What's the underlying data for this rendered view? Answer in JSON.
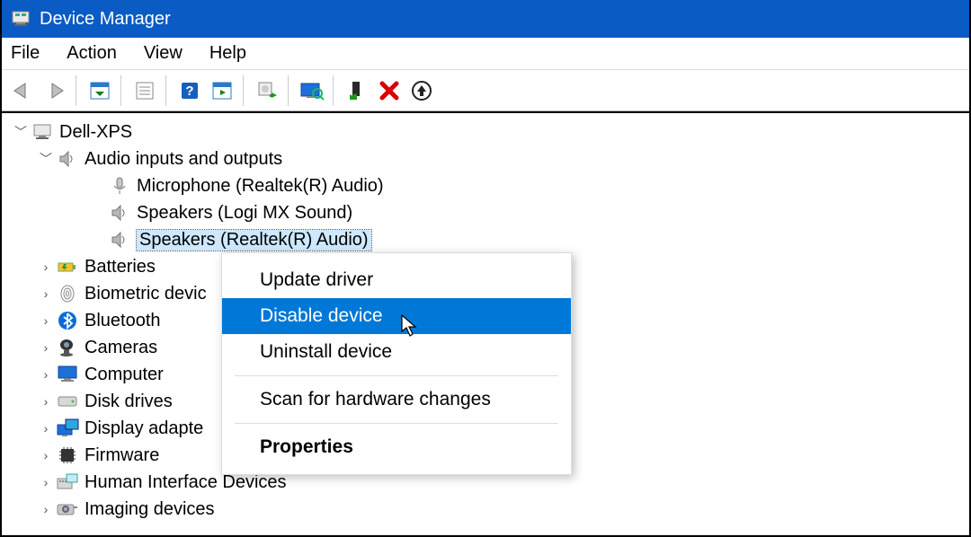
{
  "titlebar": {
    "title": "Device Manager"
  },
  "menubar": {
    "items": [
      "File",
      "Action",
      "View",
      "Help"
    ]
  },
  "toolbar": {
    "buttons": [
      "back",
      "forward",
      "sep",
      "show-hidden",
      "sep",
      "properties-console",
      "sep",
      "help",
      "action-center",
      "sep",
      "update-driver",
      "sep",
      "scan-hardware",
      "sep",
      "enable",
      "disable",
      "uninstall"
    ]
  },
  "tree": {
    "root": {
      "label": "Dell-XPS",
      "icon": "computer-root"
    },
    "audio": {
      "label": "Audio inputs and outputs",
      "items": [
        "Microphone (Realtek(R) Audio)",
        "Speakers (Logi MX Sound)",
        "Speakers (Realtek(R) Audio)"
      ],
      "selected_index": 2
    },
    "categories": [
      {
        "label": "Batteries",
        "icon": "battery"
      },
      {
        "label": "Biometric devic",
        "icon": "biometric"
      },
      {
        "label": "Bluetooth",
        "icon": "bluetooth"
      },
      {
        "label": "Cameras",
        "icon": "camera"
      },
      {
        "label": "Computer",
        "icon": "monitor"
      },
      {
        "label": "Disk drives",
        "icon": "disk"
      },
      {
        "label": "Display adapte",
        "icon": "display"
      },
      {
        "label": "Firmware",
        "icon": "firmware"
      },
      {
        "label": "Human Interface Devices",
        "icon": "hid"
      },
      {
        "label": "Imaging devices",
        "icon": "imaging"
      }
    ]
  },
  "context_menu": {
    "items": [
      {
        "label": "Update driver",
        "type": "item"
      },
      {
        "label": "Disable device",
        "type": "item",
        "highlight": true
      },
      {
        "label": "Uninstall device",
        "type": "item"
      },
      {
        "type": "sep"
      },
      {
        "label": "Scan for hardware changes",
        "type": "item"
      },
      {
        "type": "sep"
      },
      {
        "label": "Properties",
        "type": "item",
        "bold": true
      }
    ]
  }
}
